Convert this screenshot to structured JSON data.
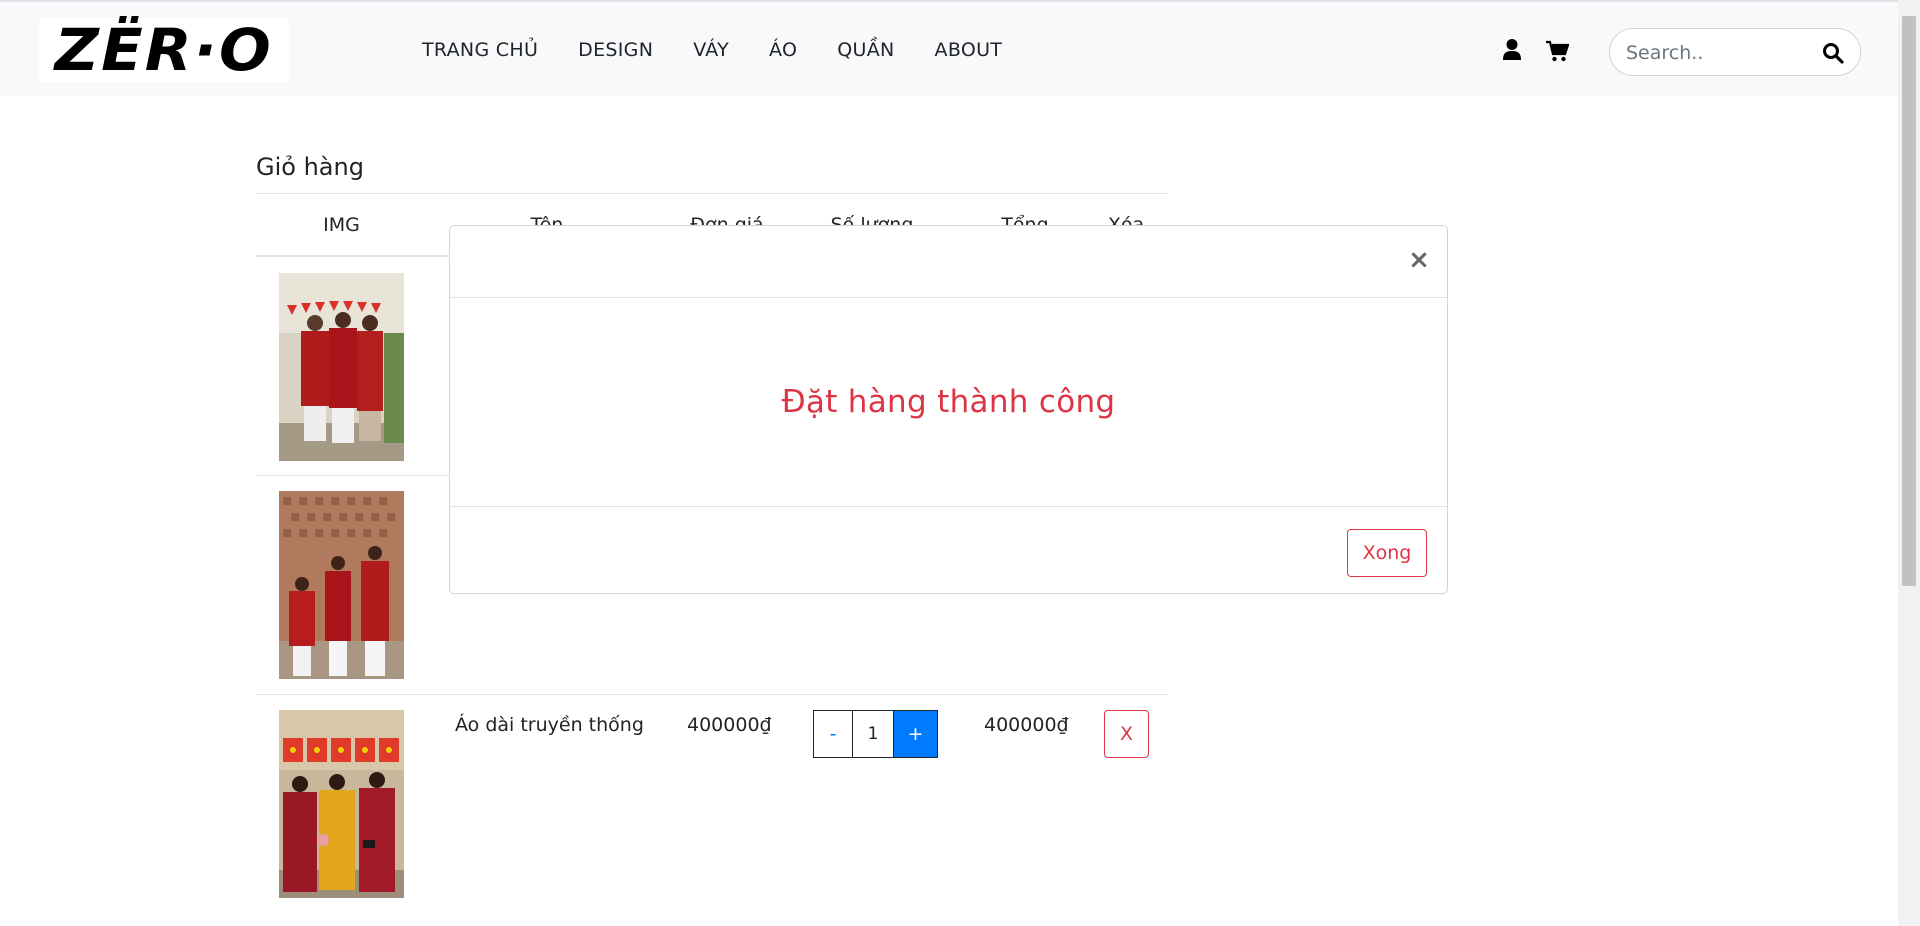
{
  "navbar": {
    "logo_text": "ZËR·O",
    "links": [
      "TRANG CHỦ",
      "DESIGN",
      "VÁY",
      "ÁO",
      "QUẦN",
      "ABOUT"
    ],
    "user_icon": "user-icon",
    "cart_icon": "cart-icon",
    "search_placeholder": "Search..",
    "search_icon": "search-icon"
  },
  "cart": {
    "title": "Giỏ hàng",
    "headers": [
      "IMG",
      "Tên",
      "Đơn giá",
      "Số lượng",
      "Tổng",
      "Xóa"
    ],
    "rows": [
      {
        "image": "photo-group-red-ao-dai"
      },
      {
        "image": "photo-group-red-white-ao-dai"
      },
      {
        "image": "photo-group-red-yellow-ao-dai",
        "name": "Áo dài truyền thống",
        "price": "400000₫",
        "qty_minus": "-",
        "qty": "1",
        "qty_plus": "+",
        "total": "400000₫",
        "delete": "X"
      }
    ]
  },
  "modal": {
    "close": "×",
    "message": "Đặt hàng thành công",
    "done_label": "Xong"
  },
  "colors": {
    "danger": "#dc3545",
    "primary": "#007bff",
    "navbar_bg": "#f8f9fa"
  }
}
